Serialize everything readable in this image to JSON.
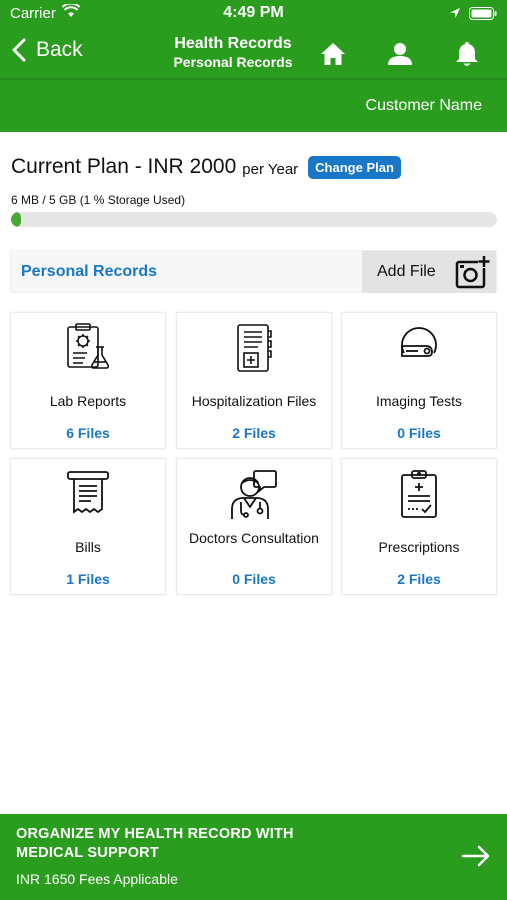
{
  "status": {
    "carrier": "Carrier",
    "time": "4:49 PM"
  },
  "nav": {
    "back_label": "Back",
    "title": "Health Records",
    "subtitle": "Personal Records",
    "customer": "Customer Name"
  },
  "plan": {
    "title": "Current Plan - INR 2000",
    "period": "per Year",
    "change_label": "Change Plan",
    "storage_text": "6 MB / 5 GB (1 % Storage Used)",
    "storage_used_fraction": 0.01
  },
  "section": {
    "title": "Personal Records",
    "add_file_label": "Add File"
  },
  "categories": [
    {
      "icon": "lab-report-icon",
      "label": "Lab Reports",
      "count": "6 Files"
    },
    {
      "icon": "hospital-file-icon",
      "label": "Hospitalization Files",
      "count": "2 Files"
    },
    {
      "icon": "imaging-scanner-icon",
      "label": "Imaging Tests",
      "count": "0 Files"
    },
    {
      "icon": "bill-receipt-icon",
      "label": "Bills",
      "count": "1 Files"
    },
    {
      "icon": "doctor-consultation-icon",
      "label": "Doctors Consultation",
      "count": "0 Files"
    },
    {
      "icon": "prescription-clipboard-icon",
      "label": "Prescriptions",
      "count": "2 Files"
    }
  ],
  "footer": {
    "title": "ORGANIZE MY HEALTH RECORD WITH MEDICAL SUPPORT",
    "subtitle": "INR 1650 Fees Applicable"
  },
  "colors": {
    "brand_green": "#2a9d1f",
    "accent_blue": "#1877c9",
    "progress_green": "#4aa837"
  }
}
